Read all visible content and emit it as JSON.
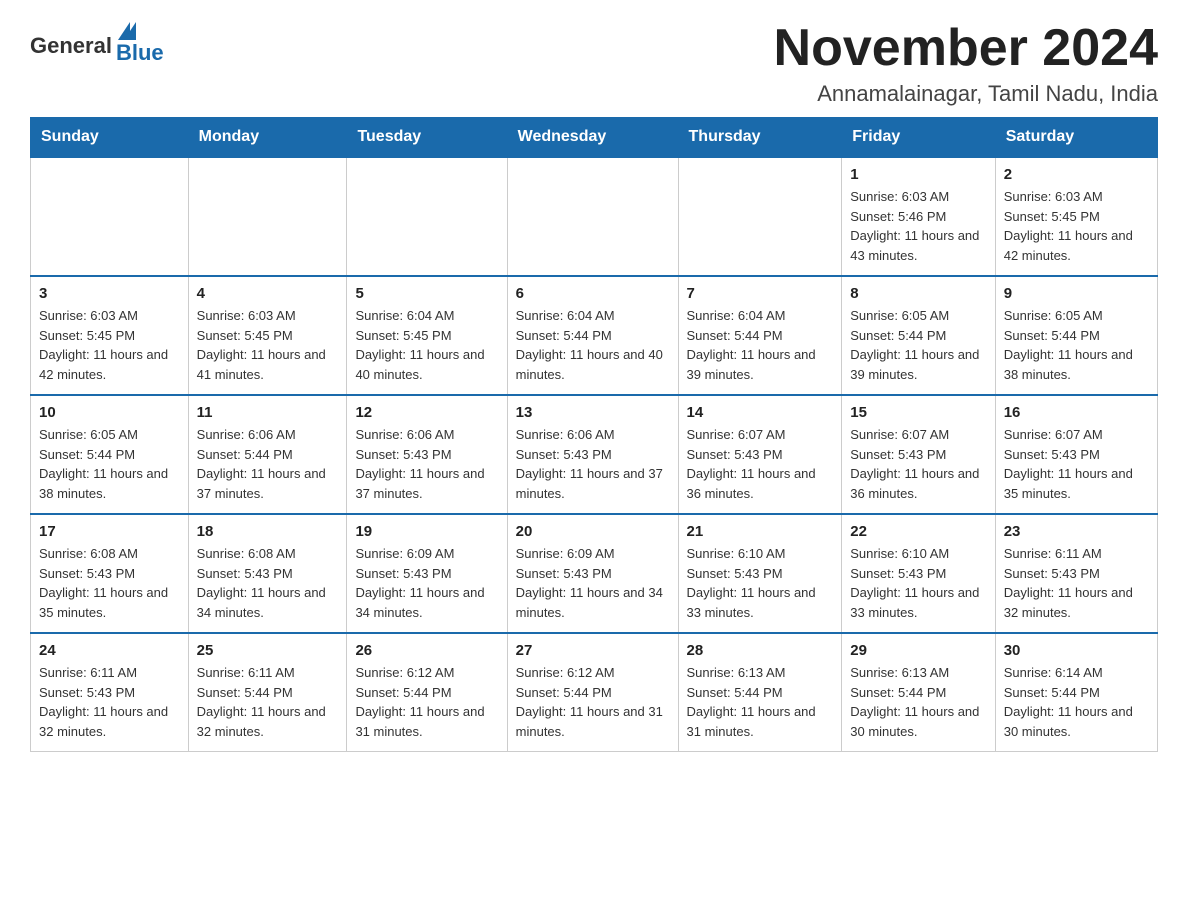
{
  "header": {
    "logo_general": "General",
    "logo_blue": "Blue",
    "title": "November 2024",
    "subtitle": "Annamalainagar, Tamil Nadu, India"
  },
  "weekdays": [
    "Sunday",
    "Monday",
    "Tuesday",
    "Wednesday",
    "Thursday",
    "Friday",
    "Saturday"
  ],
  "weeks": [
    [
      {
        "day": "",
        "sunrise": "",
        "sunset": "",
        "daylight": ""
      },
      {
        "day": "",
        "sunrise": "",
        "sunset": "",
        "daylight": ""
      },
      {
        "day": "",
        "sunrise": "",
        "sunset": "",
        "daylight": ""
      },
      {
        "day": "",
        "sunrise": "",
        "sunset": "",
        "daylight": ""
      },
      {
        "day": "",
        "sunrise": "",
        "sunset": "",
        "daylight": ""
      },
      {
        "day": "1",
        "sunrise": "Sunrise: 6:03 AM",
        "sunset": "Sunset: 5:46 PM",
        "daylight": "Daylight: 11 hours and 43 minutes."
      },
      {
        "day": "2",
        "sunrise": "Sunrise: 6:03 AM",
        "sunset": "Sunset: 5:45 PM",
        "daylight": "Daylight: 11 hours and 42 minutes."
      }
    ],
    [
      {
        "day": "3",
        "sunrise": "Sunrise: 6:03 AM",
        "sunset": "Sunset: 5:45 PM",
        "daylight": "Daylight: 11 hours and 42 minutes."
      },
      {
        "day": "4",
        "sunrise": "Sunrise: 6:03 AM",
        "sunset": "Sunset: 5:45 PM",
        "daylight": "Daylight: 11 hours and 41 minutes."
      },
      {
        "day": "5",
        "sunrise": "Sunrise: 6:04 AM",
        "sunset": "Sunset: 5:45 PM",
        "daylight": "Daylight: 11 hours and 40 minutes."
      },
      {
        "day": "6",
        "sunrise": "Sunrise: 6:04 AM",
        "sunset": "Sunset: 5:44 PM",
        "daylight": "Daylight: 11 hours and 40 minutes."
      },
      {
        "day": "7",
        "sunrise": "Sunrise: 6:04 AM",
        "sunset": "Sunset: 5:44 PM",
        "daylight": "Daylight: 11 hours and 39 minutes."
      },
      {
        "day": "8",
        "sunrise": "Sunrise: 6:05 AM",
        "sunset": "Sunset: 5:44 PM",
        "daylight": "Daylight: 11 hours and 39 minutes."
      },
      {
        "day": "9",
        "sunrise": "Sunrise: 6:05 AM",
        "sunset": "Sunset: 5:44 PM",
        "daylight": "Daylight: 11 hours and 38 minutes."
      }
    ],
    [
      {
        "day": "10",
        "sunrise": "Sunrise: 6:05 AM",
        "sunset": "Sunset: 5:44 PM",
        "daylight": "Daylight: 11 hours and 38 minutes."
      },
      {
        "day": "11",
        "sunrise": "Sunrise: 6:06 AM",
        "sunset": "Sunset: 5:44 PM",
        "daylight": "Daylight: 11 hours and 37 minutes."
      },
      {
        "day": "12",
        "sunrise": "Sunrise: 6:06 AM",
        "sunset": "Sunset: 5:43 PM",
        "daylight": "Daylight: 11 hours and 37 minutes."
      },
      {
        "day": "13",
        "sunrise": "Sunrise: 6:06 AM",
        "sunset": "Sunset: 5:43 PM",
        "daylight": "Daylight: 11 hours and 37 minutes."
      },
      {
        "day": "14",
        "sunrise": "Sunrise: 6:07 AM",
        "sunset": "Sunset: 5:43 PM",
        "daylight": "Daylight: 11 hours and 36 minutes."
      },
      {
        "day": "15",
        "sunrise": "Sunrise: 6:07 AM",
        "sunset": "Sunset: 5:43 PM",
        "daylight": "Daylight: 11 hours and 36 minutes."
      },
      {
        "day": "16",
        "sunrise": "Sunrise: 6:07 AM",
        "sunset": "Sunset: 5:43 PM",
        "daylight": "Daylight: 11 hours and 35 minutes."
      }
    ],
    [
      {
        "day": "17",
        "sunrise": "Sunrise: 6:08 AM",
        "sunset": "Sunset: 5:43 PM",
        "daylight": "Daylight: 11 hours and 35 minutes."
      },
      {
        "day": "18",
        "sunrise": "Sunrise: 6:08 AM",
        "sunset": "Sunset: 5:43 PM",
        "daylight": "Daylight: 11 hours and 34 minutes."
      },
      {
        "day": "19",
        "sunrise": "Sunrise: 6:09 AM",
        "sunset": "Sunset: 5:43 PM",
        "daylight": "Daylight: 11 hours and 34 minutes."
      },
      {
        "day": "20",
        "sunrise": "Sunrise: 6:09 AM",
        "sunset": "Sunset: 5:43 PM",
        "daylight": "Daylight: 11 hours and 34 minutes."
      },
      {
        "day": "21",
        "sunrise": "Sunrise: 6:10 AM",
        "sunset": "Sunset: 5:43 PM",
        "daylight": "Daylight: 11 hours and 33 minutes."
      },
      {
        "day": "22",
        "sunrise": "Sunrise: 6:10 AM",
        "sunset": "Sunset: 5:43 PM",
        "daylight": "Daylight: 11 hours and 33 minutes."
      },
      {
        "day": "23",
        "sunrise": "Sunrise: 6:11 AM",
        "sunset": "Sunset: 5:43 PM",
        "daylight": "Daylight: 11 hours and 32 minutes."
      }
    ],
    [
      {
        "day": "24",
        "sunrise": "Sunrise: 6:11 AM",
        "sunset": "Sunset: 5:43 PM",
        "daylight": "Daylight: 11 hours and 32 minutes."
      },
      {
        "day": "25",
        "sunrise": "Sunrise: 6:11 AM",
        "sunset": "Sunset: 5:44 PM",
        "daylight": "Daylight: 11 hours and 32 minutes."
      },
      {
        "day": "26",
        "sunrise": "Sunrise: 6:12 AM",
        "sunset": "Sunset: 5:44 PM",
        "daylight": "Daylight: 11 hours and 31 minutes."
      },
      {
        "day": "27",
        "sunrise": "Sunrise: 6:12 AM",
        "sunset": "Sunset: 5:44 PM",
        "daylight": "Daylight: 11 hours and 31 minutes."
      },
      {
        "day": "28",
        "sunrise": "Sunrise: 6:13 AM",
        "sunset": "Sunset: 5:44 PM",
        "daylight": "Daylight: 11 hours and 31 minutes."
      },
      {
        "day": "29",
        "sunrise": "Sunrise: 6:13 AM",
        "sunset": "Sunset: 5:44 PM",
        "daylight": "Daylight: 11 hours and 30 minutes."
      },
      {
        "day": "30",
        "sunrise": "Sunrise: 6:14 AM",
        "sunset": "Sunset: 5:44 PM",
        "daylight": "Daylight: 11 hours and 30 minutes."
      }
    ]
  ]
}
